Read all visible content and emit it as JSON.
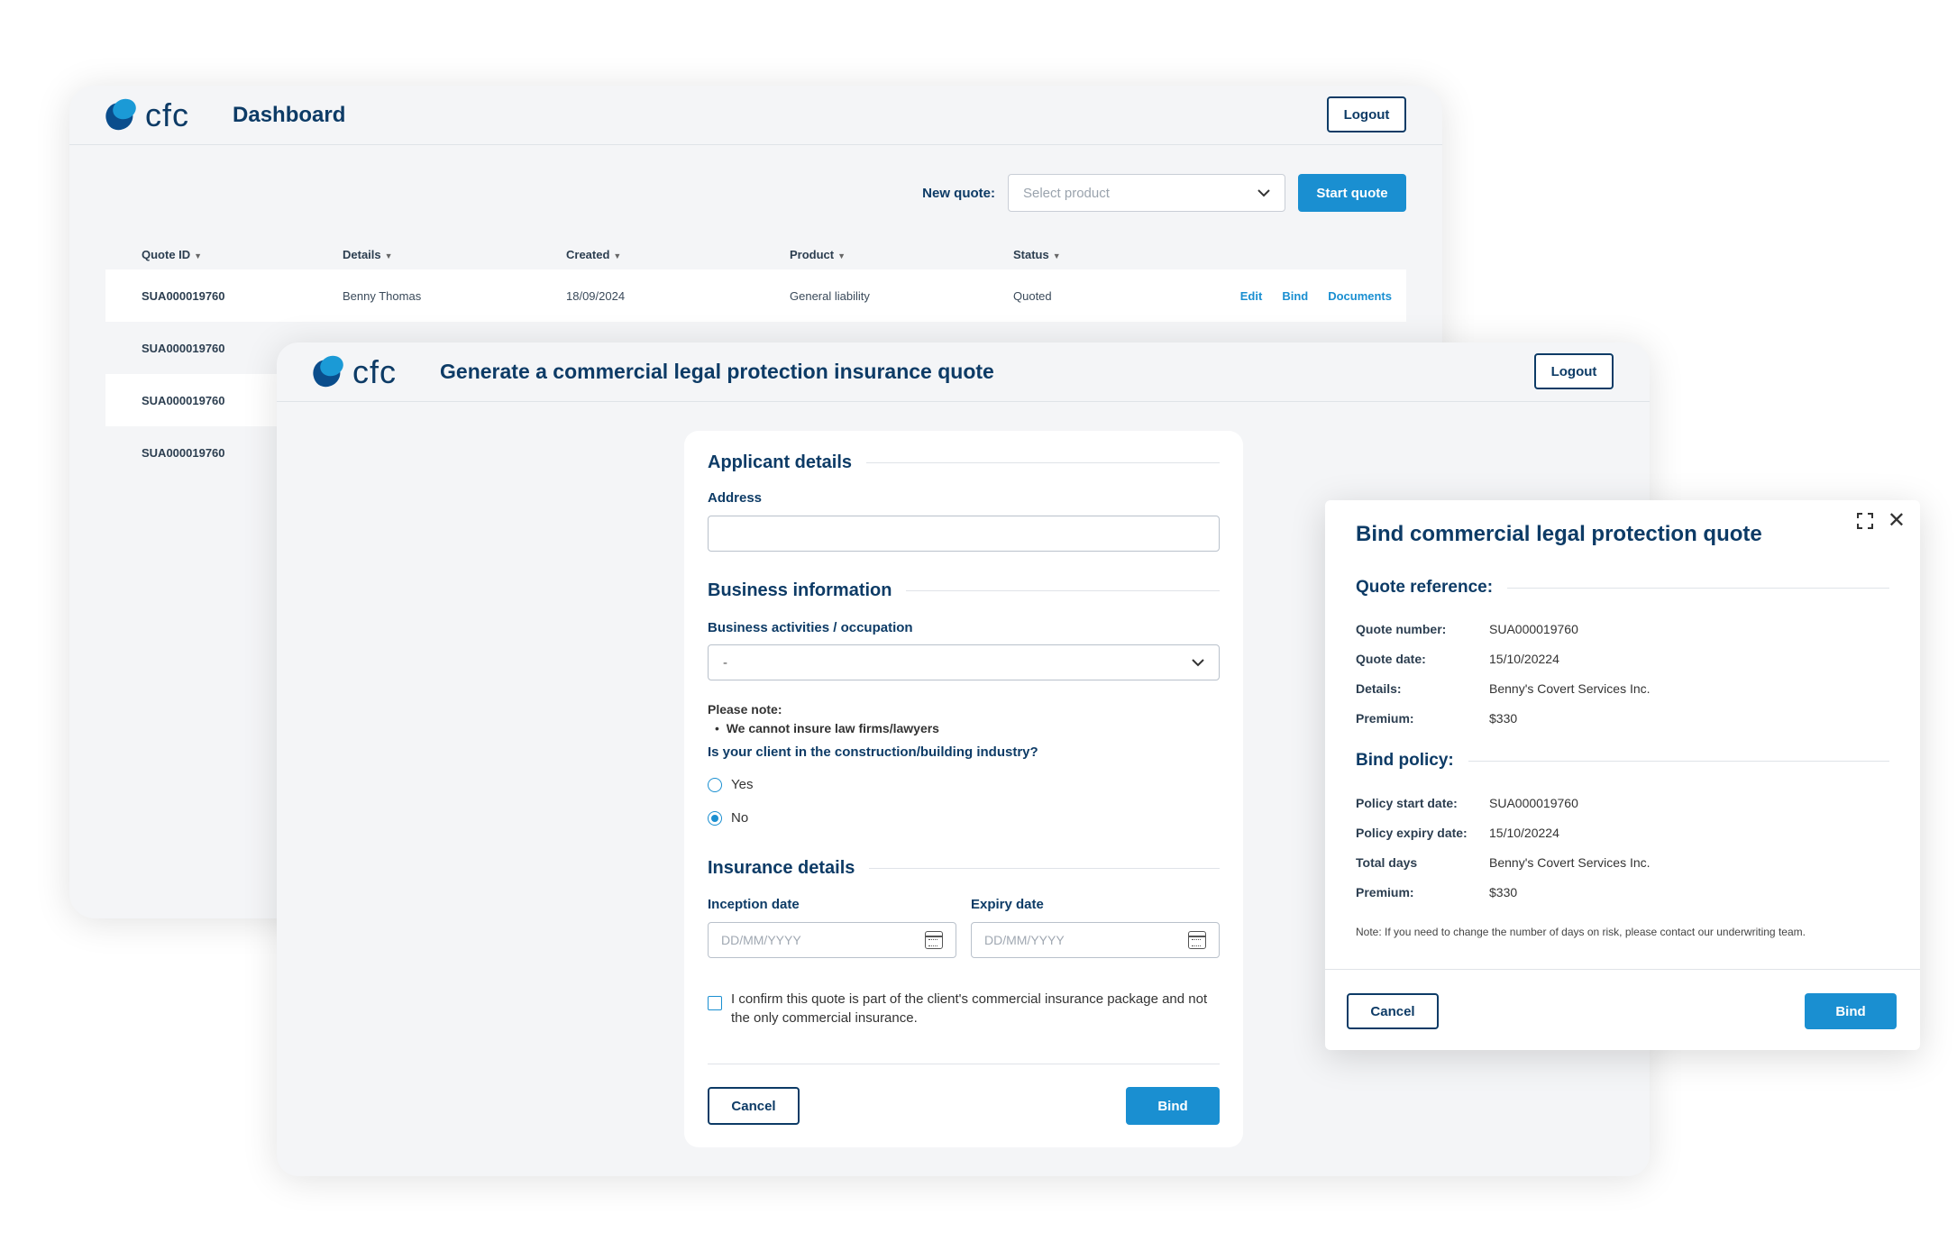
{
  "dashboard": {
    "logo_text": "cfc",
    "title": "Dashboard",
    "logout_label": "Logout",
    "new_quote_label": "New quote:",
    "select_placeholder": "Select product",
    "start_quote_label": "Start quote",
    "columns": [
      "Quote ID",
      "Details",
      "Created",
      "Product",
      "Status"
    ],
    "rows": [
      {
        "id": "SUA000019760",
        "details": "Benny Thomas",
        "created": "18/09/2024",
        "product": "General liability",
        "status": "Quoted",
        "actions": [
          "Edit",
          "Bind",
          "Documents"
        ]
      },
      {
        "id": "SUA000019760"
      },
      {
        "id": "SUA000019760"
      },
      {
        "id": "SUA000019760"
      }
    ]
  },
  "generate": {
    "logo_text": "cfc",
    "title": "Generate a commercial legal protection insurance quote",
    "logout_label": "Logout",
    "applicant_title": "Applicant details",
    "address_label": "Address",
    "business_title": "Business information",
    "activities_label": "Business activities / occupation",
    "activities_value": "-",
    "note_title": "Please note:",
    "note_item": "We cannot insure law firms/lawyers",
    "question": "Is your client in the construction/building industry?",
    "option_yes": "Yes",
    "option_no": "No",
    "selected_option": "No",
    "insurance_title": "Insurance details",
    "inception_label": "Inception date",
    "expiry_label": "Expiry date",
    "date_placeholder": "DD/MM/YYYY",
    "confirm_text": "I confirm this quote is part of the client's commercial insurance package and not the only commercial insurance.",
    "cancel_label": "Cancel",
    "bind_label": "Bind"
  },
  "bind_modal": {
    "title": "Bind commercial legal protection quote",
    "quote_ref_title": "Quote reference:",
    "quote_ref": [
      {
        "k": "Quote number:",
        "v": "SUA000019760"
      },
      {
        "k": "Quote date:",
        "v": "15/10/20224"
      },
      {
        "k": "Details:",
        "v": "Benny's Covert Services Inc."
      },
      {
        "k": "Premium:",
        "v": "$330"
      }
    ],
    "bind_policy_title": "Bind policy:",
    "bind_policy": [
      {
        "k": "Policy start date:",
        "v": "SUA000019760"
      },
      {
        "k": "Policy expiry date:",
        "v": "15/10/20224"
      },
      {
        "k": "Total days",
        "v": "Benny's Covert Services Inc."
      },
      {
        "k": "Premium:",
        "v": "$330"
      }
    ],
    "note": "Note: If you need to change the number of days on risk, please contact our underwriting team.",
    "cancel_label": "Cancel",
    "bind_label": "Bind"
  },
  "colors": {
    "primary": "#1a8fd1",
    "navy": "#0d3b66",
    "window_bg": "#f4f5f7"
  }
}
